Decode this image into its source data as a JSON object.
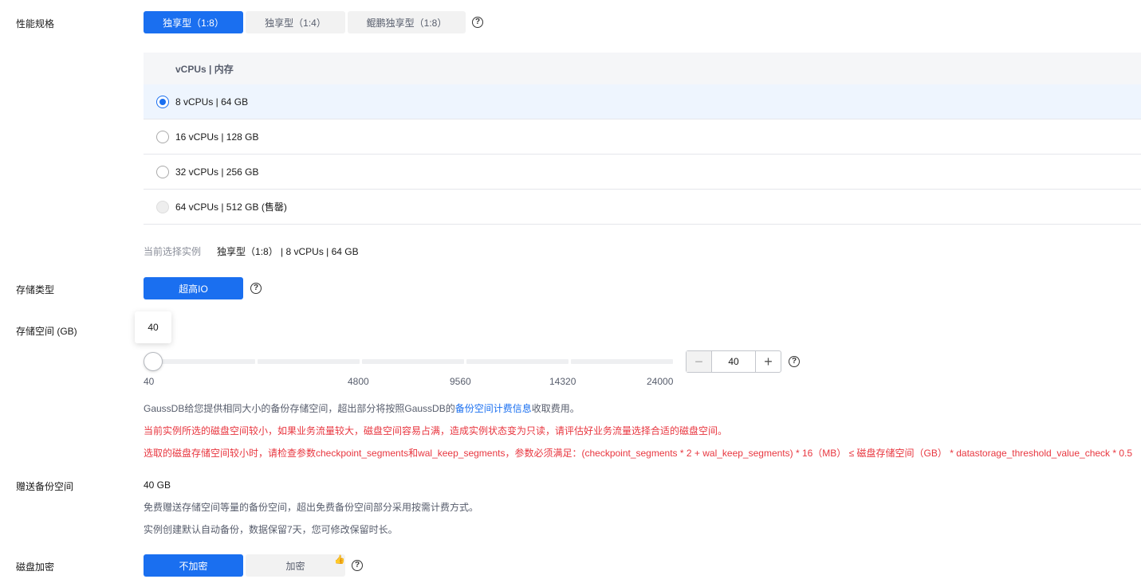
{
  "perf": {
    "label": "性能规格",
    "tabs": [
      {
        "label": "独享型（1:8）",
        "active": true
      },
      {
        "label": "独享型（1:4）",
        "active": false
      },
      {
        "label": "鲲鹏独享型（1:8）",
        "active": false
      }
    ],
    "help": "?",
    "table_header": "vCPUs | 内存",
    "rows": [
      {
        "label": "8 vCPUs | 64 GB",
        "state": "checked"
      },
      {
        "label": "16 vCPUs | 128 GB",
        "state": "unchecked"
      },
      {
        "label": "32 vCPUs | 256 GB",
        "state": "unchecked"
      },
      {
        "label": "64 vCPUs | 512 GB (售罄)",
        "state": "disabled"
      }
    ],
    "current_label": "当前选择实例",
    "current_value": "独享型（1:8） | 8 vCPUs | 64 GB"
  },
  "storage_type": {
    "label": "存储类型",
    "option": "超高IO",
    "help": "?"
  },
  "storage_space": {
    "label": "存储空间 (GB)",
    "tooltip": "40",
    "value": "40",
    "ticks": [
      "40",
      "4800",
      "9560",
      "14320",
      "24000"
    ],
    "minus": "−",
    "plus": "+",
    "help": "?",
    "note_prefix": "GaussDB给您提供相同大小的备份存储空间，超出部分将按照GaussDB的",
    "note_link": "备份空间计费信息",
    "note_suffix": "收取费用。",
    "warning1": "当前实例所选的磁盘空间较小，如果业务流量较大，磁盘空间容易占满，造成实例状态变为只读，请评估好业务流量选择合适的磁盘空间。",
    "warning2": "选取的磁盘存储空间较小时，请检查参数checkpoint_segments和wal_keep_segments，参数必须满足：(checkpoint_segments * 2 + wal_keep_segments) * 16（MB） ≤ 磁盘存储空间（GB） * datastorage_threshold_value_check * 0.5"
  },
  "backup": {
    "label": "赠送备份空间",
    "value": "40 GB",
    "note1": "免费赠送存储空间等量的备份空间，超出免费备份空间部分采用按需计费方式。",
    "note2": "实例创建默认自动备份，数据保留7天，您可修改保留时长。"
  },
  "encrypt": {
    "label": "磁盘加密",
    "options": [
      {
        "label": "不加密",
        "active": true
      },
      {
        "label": "加密",
        "active": false
      }
    ],
    "help": "?"
  },
  "colors": {
    "accent": "#1a6ff0",
    "warning": "#e8363f"
  }
}
